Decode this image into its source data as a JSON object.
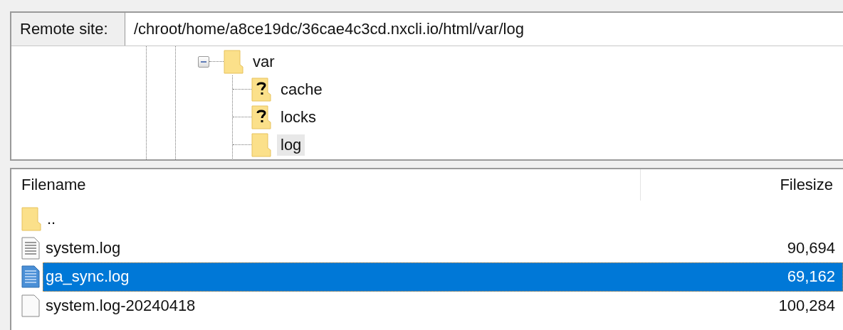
{
  "remote_site": {
    "label": "Remote site:",
    "value": "/chroot/home/a8ce19dc/36cae4c3cd.nxcli.io/html/var/log"
  },
  "tree": [
    {
      "label": "var",
      "kind": "folder",
      "expanded": true,
      "selected": false,
      "children": [
        {
          "label": "cache",
          "kind": "unknown-folder",
          "selected": false
        },
        {
          "label": "locks",
          "kind": "unknown-folder",
          "selected": false
        },
        {
          "label": "log",
          "kind": "folder",
          "selected": true
        }
      ]
    }
  ],
  "file_list": {
    "columns": [
      "Filename",
      "Filesize"
    ],
    "rows": [
      {
        "name": "..",
        "size": "",
        "kind": "folder",
        "selected": false
      },
      {
        "name": "system.log",
        "size": "90,694",
        "kind": "text-file",
        "selected": false
      },
      {
        "name": "ga_sync.log",
        "size": "69,162",
        "kind": "text-file",
        "selected": true
      },
      {
        "name": "system.log-20240418",
        "size": "100,284",
        "kind": "file",
        "selected": false
      }
    ]
  }
}
